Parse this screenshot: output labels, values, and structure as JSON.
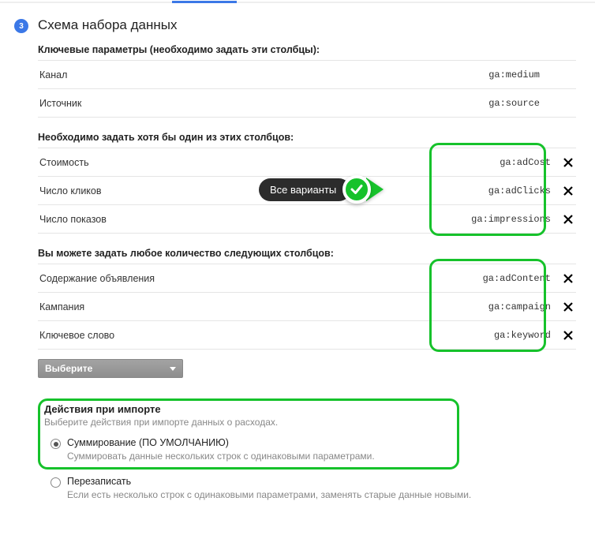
{
  "step": {
    "number": "3",
    "title": "Схема набора данных"
  },
  "key_section": {
    "heading": "Ключевые параметры (необходимо задать эти столбцы):",
    "rows": [
      {
        "label": "Канал",
        "code": "ga:medium"
      },
      {
        "label": "Источник",
        "code": "ga:source"
      }
    ]
  },
  "one_section": {
    "heading": "Необходимо задать хотя бы один из этих столбцов:",
    "rows": [
      {
        "label": "Стоимость",
        "code": "ga:adCost"
      },
      {
        "label": "Число кликов",
        "code": "ga:adClicks"
      },
      {
        "label": "Число показов",
        "code": "ga:impressions"
      }
    ]
  },
  "any_section": {
    "heading": "Вы можете задать любое количество следующих столбцов:",
    "rows": [
      {
        "label": "Содержание объявления",
        "code": "ga:adContent"
      },
      {
        "label": "Кампания",
        "code": "ga:campaign"
      },
      {
        "label": "Ключевое слово",
        "code": "ga:keyword"
      }
    ]
  },
  "select": {
    "placeholder": "Выберите"
  },
  "callout": {
    "text": "Все варианты"
  },
  "import": {
    "title": "Действия при импорте",
    "subtitle": "Выберите действия при импорте данных о расходах.",
    "options": [
      {
        "label": "Суммирование (ПО УМОЛЧАНИЮ)",
        "desc": "Суммировать данные нескольких строк с одинаковыми параметрами.",
        "checked": true
      },
      {
        "label": "Перезаписать",
        "desc": "Если есть несколько строк с одинаковыми параметрами, заменять старые данные новыми.",
        "checked": false
      }
    ]
  }
}
